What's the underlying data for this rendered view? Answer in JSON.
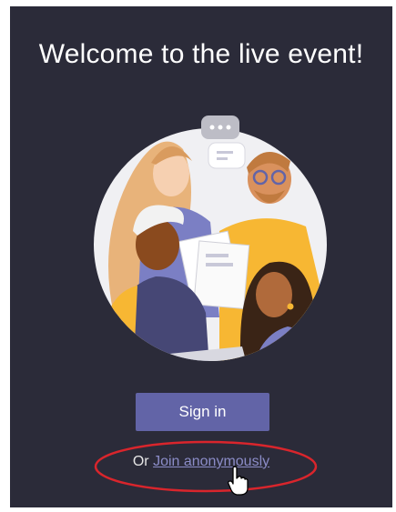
{
  "welcome": {
    "title": "Welcome to the live event!"
  },
  "illustration": {
    "icon": "people-illustration",
    "bubble_icon": "chat-bubble-icon"
  },
  "auth": {
    "signin_label": "Sign in",
    "or_text": "Or ",
    "join_label": "Join anonymously"
  },
  "annotation": {
    "color": "#d9252c"
  },
  "cursor": {
    "icon": "hand-pointer-icon"
  },
  "colors": {
    "background": "#2b2b39",
    "accent": "#6264a7",
    "link": "#8b8cc7"
  }
}
